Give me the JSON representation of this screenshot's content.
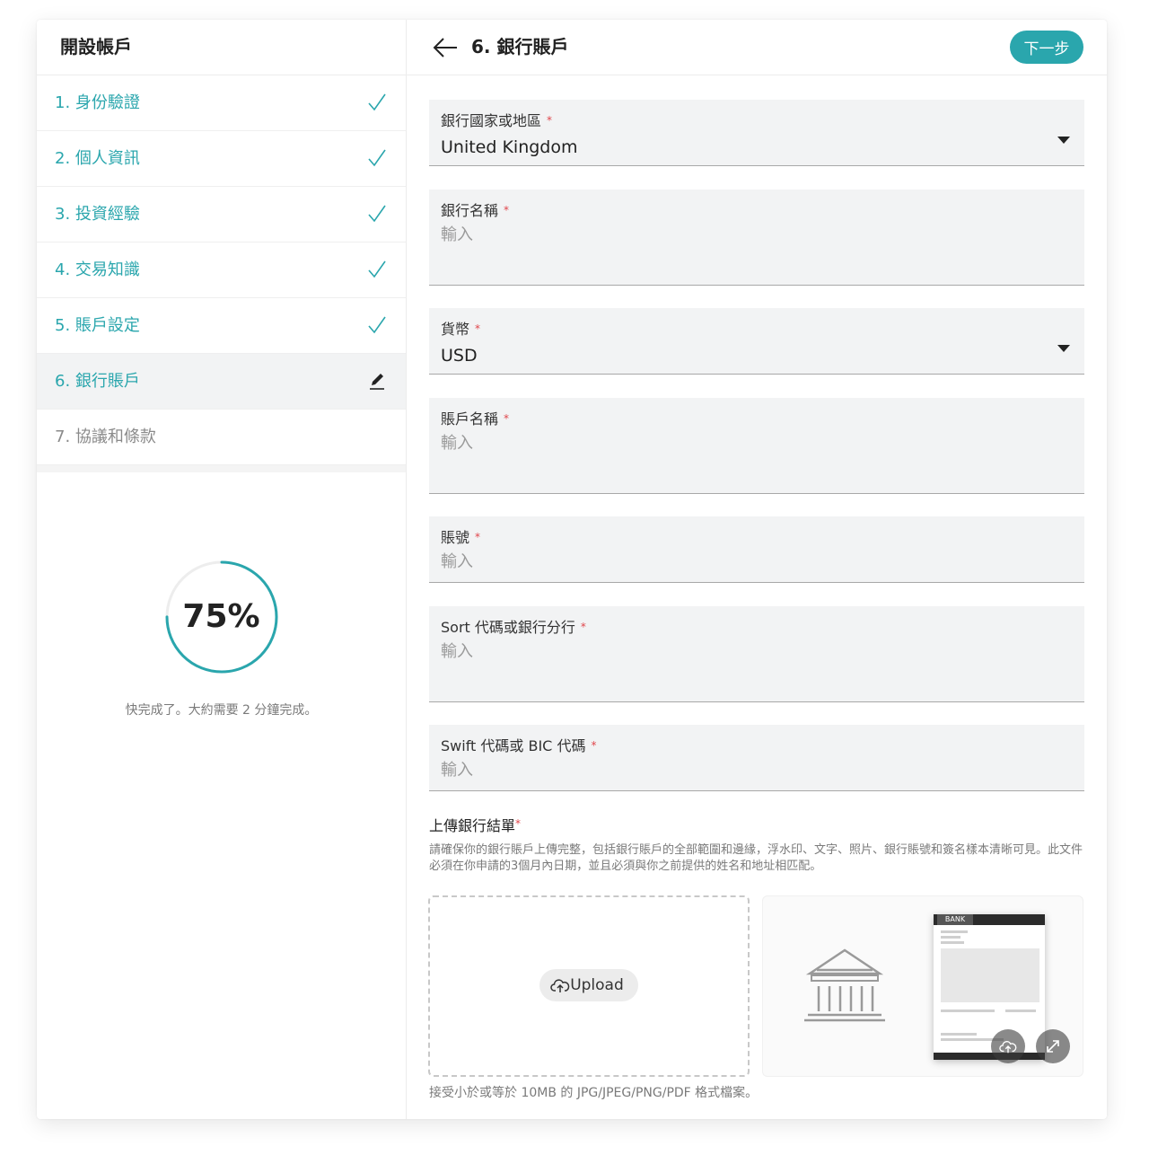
{
  "left": {
    "title": "開設帳戶",
    "steps": [
      {
        "label": "1. 身份驗證",
        "status": "done"
      },
      {
        "label": "2. 個人資訊",
        "status": "done"
      },
      {
        "label": "3. 投資經驗",
        "status": "done"
      },
      {
        "label": "4. 交易知識",
        "status": "done"
      },
      {
        "label": "5. 賬戶設定",
        "status": "done"
      },
      {
        "label": "6. 銀行賬戶",
        "status": "editing"
      },
      {
        "label": "7. 協議和條款",
        "status": "pending"
      }
    ],
    "progress": {
      "value": 75,
      "label": "75%",
      "message": "快完成了。大約需要 2 分鐘完成。"
    }
  },
  "header": {
    "title": "6. 銀行賬戶",
    "next_label": "下一步"
  },
  "form": {
    "country": {
      "label": "銀行國家或地區",
      "required_mark": "*",
      "value": "United Kingdom"
    },
    "bank_name": {
      "label": "銀行名稱",
      "required_mark": "*",
      "placeholder": "輸入"
    },
    "currency": {
      "label": "貨幣",
      "required_mark": "*",
      "value": "USD"
    },
    "account_name": {
      "label": "賬戶名稱",
      "required_mark": "*",
      "placeholder": "輸入"
    },
    "account_number": {
      "label": "賬號",
      "required_mark": "*",
      "placeholder": "輸入"
    },
    "sort_code": {
      "label": "Sort 代碼或銀行分行",
      "required_mark": "*",
      "placeholder": "輸入"
    },
    "swift": {
      "label": "Swift 代碼或 BIC 代碼",
      "required_mark": "*",
      "placeholder": "輸入"
    }
  },
  "upload": {
    "title": "上傳銀行結單",
    "required_mark": "*",
    "description": "請確保你的銀行賬戶上傳完整，包括銀行賬戶的全部範圍和邊緣，浮水印、文字、照片、銀行賬號和簽名樣本清晰可見。此文件必須在你申請的3個月內日期，並且必須與你之前提供的姓名和地址相匹配。",
    "button_label": "Upload",
    "sample_doc_label": "BANK",
    "accept_note": "接受小於或等於 10MB 的 JPG/JPEG/PNG/PDF 格式檔案。"
  },
  "colors": {
    "accent": "#2aa6ad",
    "required": "#e0464b",
    "field_bg": "#f2f3f4"
  }
}
